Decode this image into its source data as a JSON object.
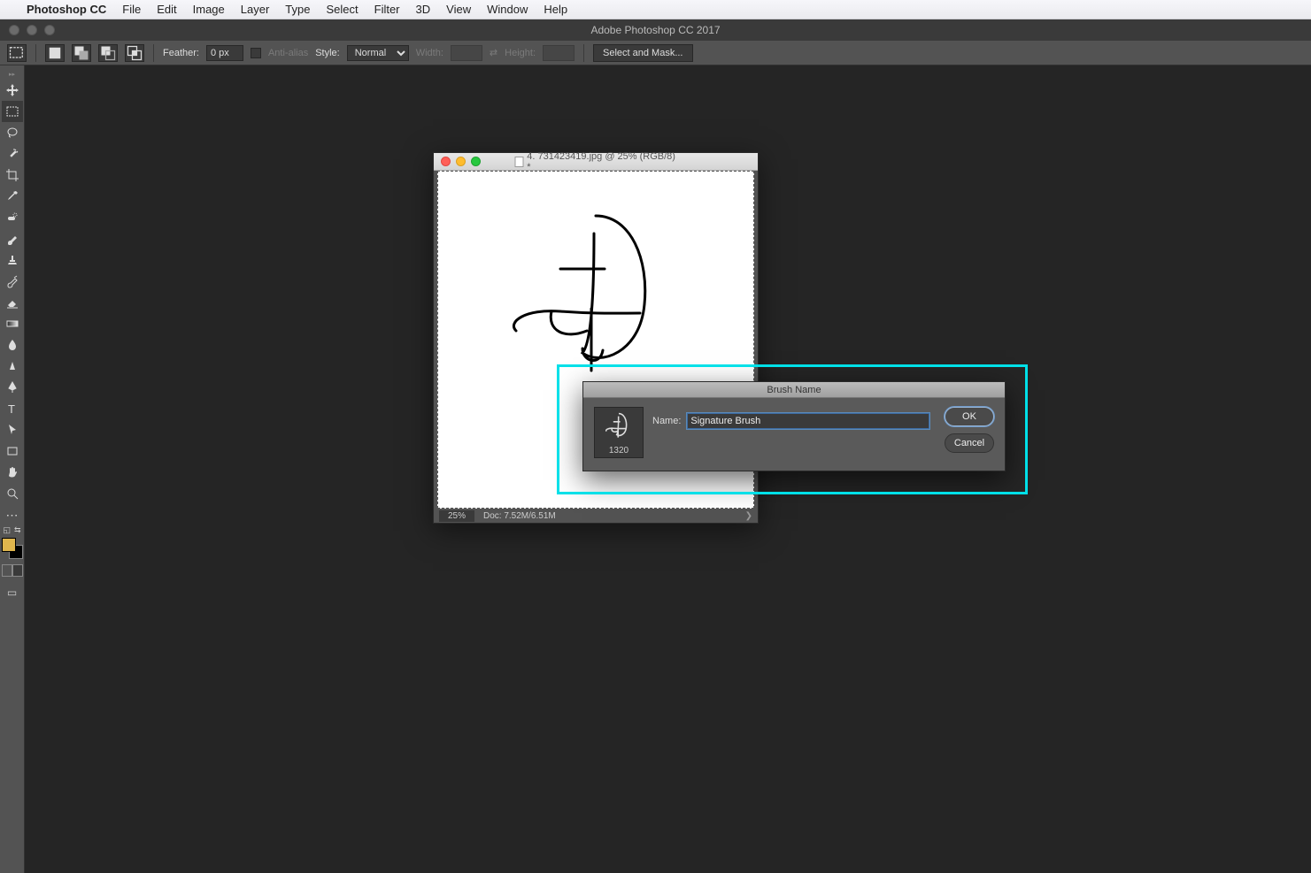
{
  "menubar": {
    "appname": "Photoshop CC",
    "items": [
      "File",
      "Edit",
      "Image",
      "Layer",
      "Type",
      "Select",
      "Filter",
      "3D",
      "View",
      "Window",
      "Help"
    ]
  },
  "app_title": "Adobe Photoshop CC 2017",
  "optionsbar": {
    "feather_label": "Feather:",
    "feather_value": "0 px",
    "antialias_label": "Anti-alias",
    "style_label": "Style:",
    "style_value": "Normal",
    "width_label": "Width:",
    "height_label": "Height:",
    "mask_button": "Select and Mask..."
  },
  "tools": {
    "items": [
      "move-tool",
      "marquee-tool",
      "lasso-tool",
      "magic-wand-tool",
      "crop-tool",
      "eyedropper-tool",
      "spot-healing-tool",
      "brush-tool",
      "clone-stamp-tool",
      "history-brush-tool",
      "eraser-tool",
      "gradient-tool",
      "blur-tool",
      "dodge-tool",
      "pen-tool",
      "type-tool",
      "path-selection-tool",
      "rectangle-tool",
      "hand-tool",
      "zoom-tool",
      "edit-toolbar"
    ]
  },
  "document": {
    "title": "4. 731423419.jpg @ 25% (RGB/8) *",
    "zoom": "25%",
    "docinfo": "Doc: 7.52M/6.51M"
  },
  "dialog": {
    "title": "Brush Name",
    "name_label": "Name:",
    "name_value": "Signature Brush",
    "preview_size": "1320",
    "ok": "OK",
    "cancel": "Cancel"
  }
}
